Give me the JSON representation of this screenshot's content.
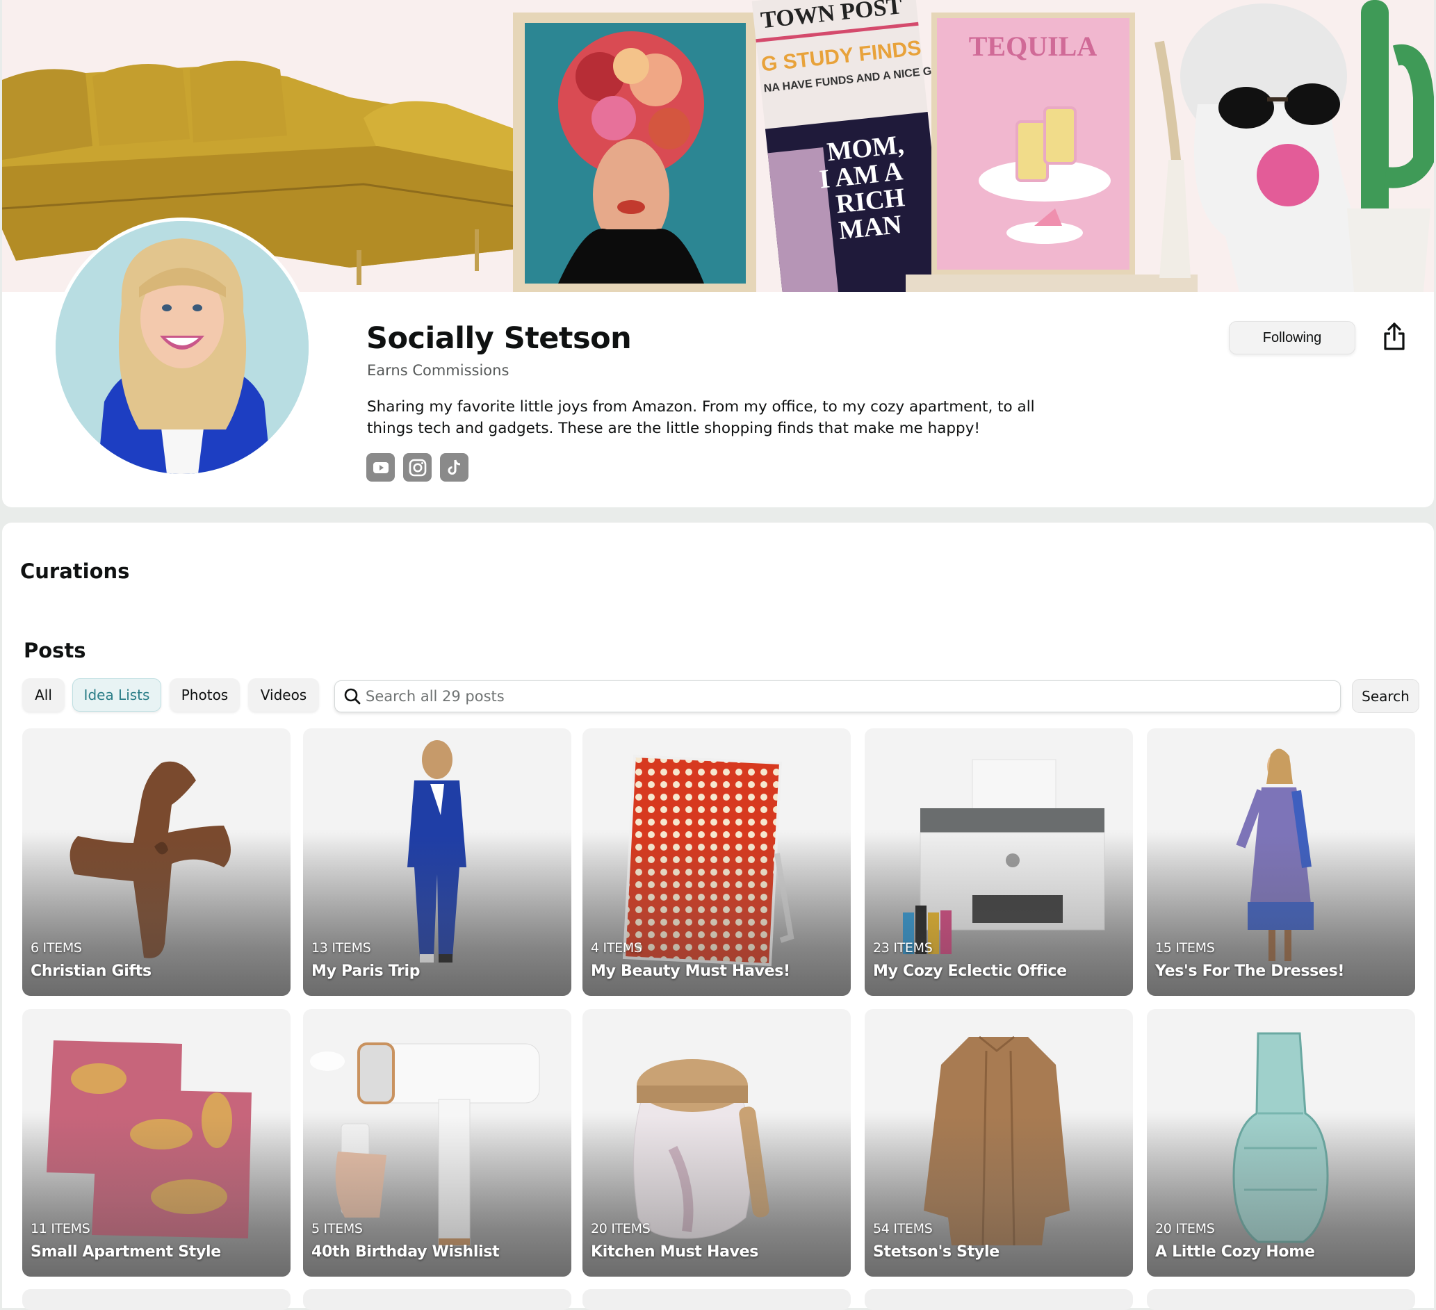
{
  "profile": {
    "name": "Socially Stetson",
    "subtitle": "Earns Commissions",
    "bio": "Sharing my favorite little joys from Amazon. From my office, to my cozy apartment, to all things tech and gadgets. These are the little shopping finds that make me happy!",
    "social_icons": [
      "youtube-icon",
      "instagram-icon",
      "tiktok-icon"
    ],
    "following_label": "Following",
    "share_icon": "share-icon"
  },
  "banner": {
    "poster_tequila_text": "TEQUILA",
    "newspaper_masthead": "TOWN POST",
    "newspaper_headline": "G STUDY FINDS",
    "newspaper_subhead": "NA HAVE FUNDS AND A NICE GUY!",
    "newspaper_big": "MOM, I AM A RICH MAN"
  },
  "sections": {
    "curations": "Curations",
    "posts": "Posts"
  },
  "filters": {
    "chips": [
      {
        "label": "All",
        "active": false
      },
      {
        "label": "Idea Lists",
        "active": true
      },
      {
        "label": "Photos",
        "active": false
      },
      {
        "label": "Videos",
        "active": false
      }
    ],
    "search_placeholder": "Search all 29 posts",
    "search_button": "Search"
  },
  "colors": {
    "active_chip_text": "#2a7d87",
    "active_chip_bg": "#e8f3f4",
    "page_bg": "#e9ecea",
    "banner_bg": "#f9efee"
  },
  "idea_lists": [
    {
      "count": "6 ITEMS",
      "title": "Christian Gifts"
    },
    {
      "count": "13 ITEMS",
      "title": "My Paris Trip"
    },
    {
      "count": "4 ITEMS",
      "title": "My Beauty Must Haves!"
    },
    {
      "count": "23 ITEMS",
      "title": "My Cozy Eclectic Office"
    },
    {
      "count": "15 ITEMS",
      "title": "Yes's For The Dresses!"
    },
    {
      "count": "11 ITEMS",
      "title": "Small Apartment Style"
    },
    {
      "count": "5 ITEMS",
      "title": "40th Birthday Wishlist"
    },
    {
      "count": "20 ITEMS",
      "title": "Kitchen Must Haves"
    },
    {
      "count": "54 ITEMS",
      "title": "Stetson's Style"
    },
    {
      "count": "20 ITEMS",
      "title": "A Little Cozy Home"
    }
  ]
}
